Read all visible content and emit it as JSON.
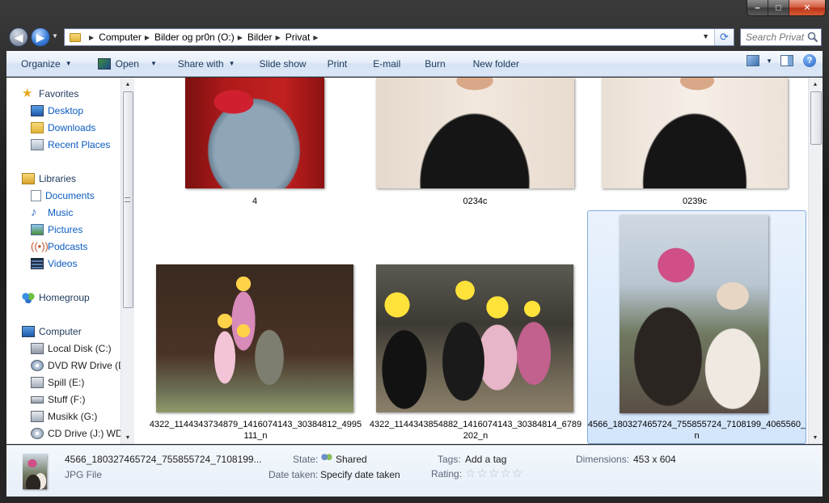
{
  "window": {
    "caption": {
      "minimize": "–",
      "maximize": "□",
      "close": "✕"
    }
  },
  "nav": {
    "back_symbol": "◀",
    "forward_symbol": "▶",
    "breadcrumb": [
      "Computer",
      "Bilder og pr0n (O:)",
      "Bilder",
      "Privat"
    ],
    "search_placeholder": "Search Privat"
  },
  "toolbar": {
    "organize": "Organize",
    "open": "Open",
    "share_with": "Share with",
    "slide_show": "Slide show",
    "print": "Print",
    "email": "E-mail",
    "burn": "Burn",
    "new_folder": "New folder",
    "help": "?"
  },
  "sidebar": {
    "favorites": {
      "label": "Favorites",
      "items": [
        "Desktop",
        "Downloads",
        "Recent Places"
      ]
    },
    "libraries": {
      "label": "Libraries",
      "items": [
        "Documents",
        "Music",
        "Pictures",
        "Podcasts",
        "Videos"
      ]
    },
    "homegroup": "Homegroup",
    "computer": {
      "label": "Computer",
      "items": [
        "Local Disk (C:)",
        "DVD RW Drive (D",
        "Spill (E:)",
        "Stuff (F:)",
        "Musikk (G:)",
        "CD Drive (J:) WD"
      ]
    }
  },
  "files": [
    {
      "name": "4"
    },
    {
      "name": "0234c"
    },
    {
      "name": "0239c"
    },
    {
      "name_line1": "4322_1144343734879_1416074143_30384812_4995",
      "name_line2": "111_n"
    },
    {
      "name_line1": "4322_1144343854882_1416074143_30384814_6789",
      "name_line2": "202_n"
    },
    {
      "name_line1": "4566_180327465724_755855724_7108199_4065560_",
      "name_line2": "n",
      "selected": true
    }
  ],
  "details": {
    "filename": "4566_180327465724_755855724_7108199...",
    "filetype": "JPG File",
    "state_label": "State:",
    "state_value": "Shared",
    "date_label": "Date taken:",
    "date_value": "Specify date taken",
    "tags_label": "Tags:",
    "tags_value": "Add a tag",
    "rating_label": "Rating:",
    "rating_stars": 0,
    "dimensions_label": "Dimensions:",
    "dimensions_value": "453 x 604"
  },
  "colors": {
    "accent": "#0b5bc1",
    "selection_border": "#84acdd",
    "toolbar_text": "#1e395b"
  }
}
